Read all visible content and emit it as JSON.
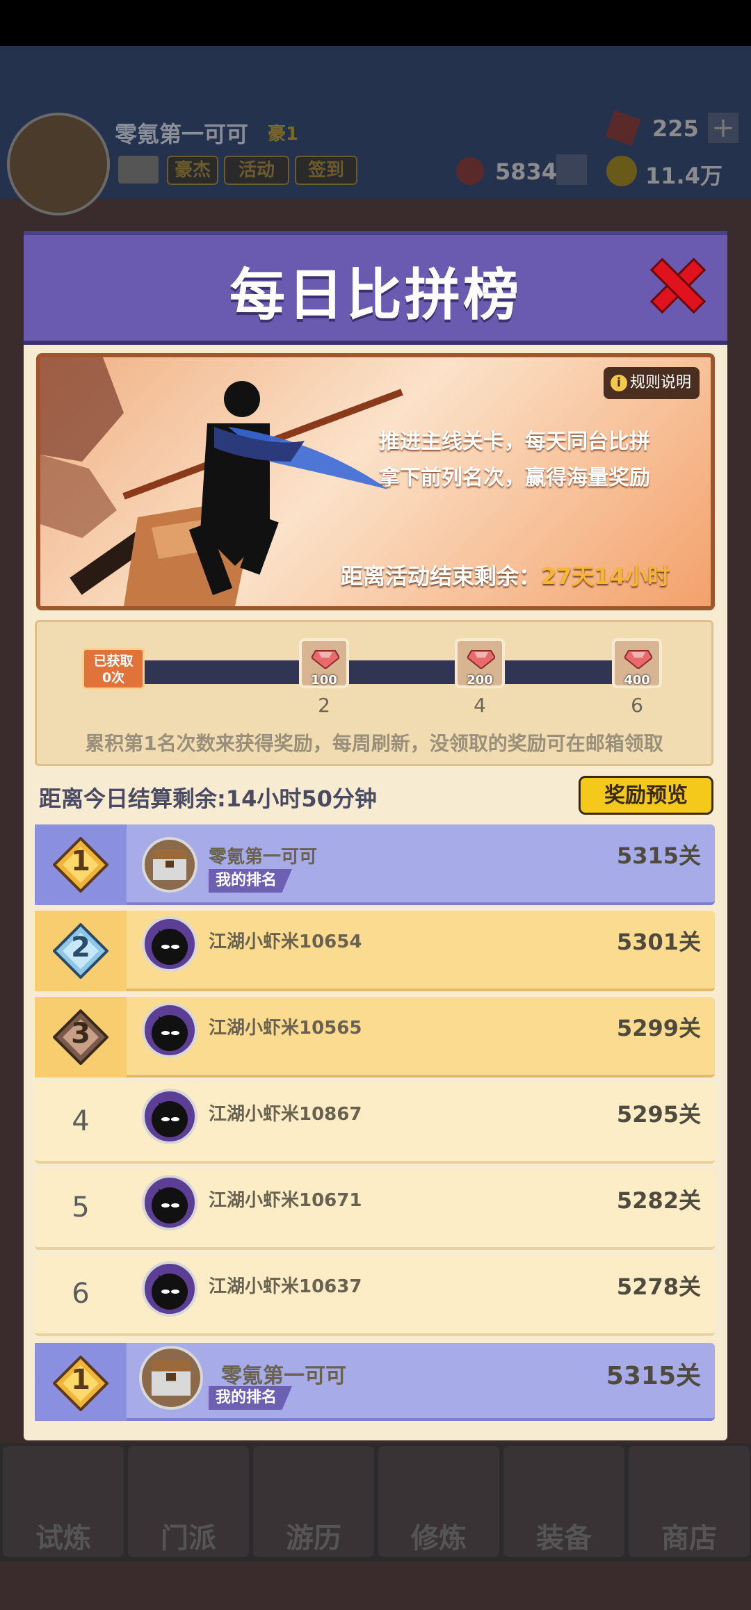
{
  "background": {
    "player_name": "零氪第一可可",
    "player_badge": "豪1",
    "tags": [
      "豪杰",
      "活动",
      "签到"
    ],
    "gems": "225",
    "rank_points": "5834",
    "gold": "11.4万",
    "nav": [
      "试炼",
      "门派",
      "游历",
      "修炼",
      "装备",
      "商店"
    ]
  },
  "dialog": {
    "title": "每日比拼榜",
    "rules_label": "规则说明",
    "rules_icon": "i",
    "banner_line1": "推进主线关卡，每天同台比拼",
    "banner_line2": "拿下前列名次，赢得海量奖励",
    "countdown_label": "距离活动结束剩余：",
    "countdown_value": "27天14小时",
    "obtained_label_1": "已获取",
    "obtained_label_2": "0次",
    "rewards": [
      {
        "amount": "100",
        "step": "2"
      },
      {
        "amount": "200",
        "step": "4"
      },
      {
        "amount": "400",
        "step": "6"
      }
    ],
    "progress_note": "累积第1名次数来获得奖励，每周刷新，没领取的奖励可在邮箱领取",
    "daily_remaining": "距离今日结算剩余:14小时50分钟",
    "preview_button": "奖励预览",
    "ranking": [
      {
        "rank": "1",
        "name": "零氪第一可可",
        "score": "5315关",
        "me": true,
        "tag": "我的排名"
      },
      {
        "rank": "2",
        "name": "江湖小虾米10654",
        "score": "5301关"
      },
      {
        "rank": "3",
        "name": "江湖小虾米10565",
        "score": "5299关"
      },
      {
        "rank": "4",
        "name": "江湖小虾米10867",
        "score": "5295关"
      },
      {
        "rank": "5",
        "name": "江湖小虾米10671",
        "score": "5282关"
      },
      {
        "rank": "6",
        "name": "江湖小虾米10637",
        "score": "5278关"
      }
    ],
    "my_rank": {
      "rank": "1",
      "name": "零氪第一可可",
      "score": "5315关",
      "tag": "我的排名"
    }
  },
  "colors": {
    "header": "#6b5bb0",
    "my_row": "#a7abe8",
    "top_row": "#fbdb90",
    "normal_row": "#fcedc7",
    "countdown_accent": "#f7b733",
    "preview_button": "#f5c81c"
  },
  "icons": [
    "close-icon",
    "info-icon",
    "gem-icon",
    "rank-medal-icon",
    "ninja-avatar-icon",
    "treasure-chest-avatar-icon"
  ]
}
